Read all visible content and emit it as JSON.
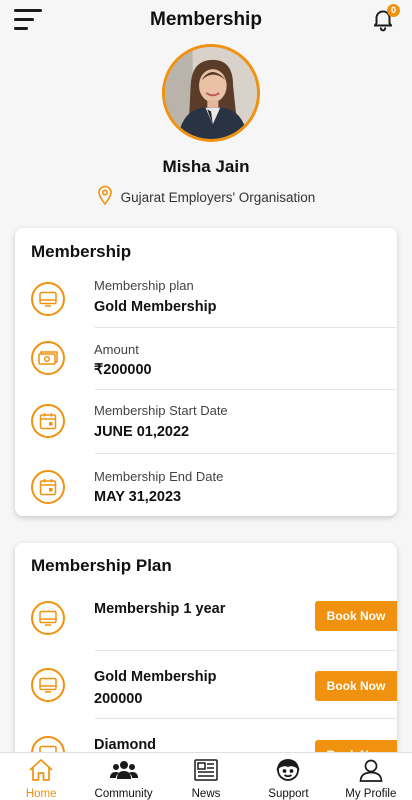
{
  "header": {
    "title": "Membership",
    "notification_count": "0"
  },
  "profile": {
    "name": "Misha Jain",
    "organisation": "Gujarat Employers' Organisation"
  },
  "membership_card": {
    "title": "Membership",
    "rows": [
      {
        "label": "Membership plan",
        "value": "Gold Membership",
        "icon": "membership-card-icon"
      },
      {
        "label": "Amount",
        "value": "₹200000",
        "icon": "cash-icon"
      },
      {
        "label": "Membership Start Date",
        "value": "JUNE 01,2022",
        "icon": "calendar-icon"
      },
      {
        "label": "Membership End Date",
        "value": "MAY 31,2023",
        "icon": "calendar-icon"
      }
    ]
  },
  "plans_card": {
    "title": "Membership Plan",
    "plans": [
      {
        "name": "Membership 1 year",
        "price": "",
        "button": "Book Now"
      },
      {
        "name": "Gold Membership",
        "price": "200000",
        "button": "Book Now"
      },
      {
        "name": "Diamond",
        "price": "",
        "button": "Book Now"
      }
    ]
  },
  "bottom_nav": {
    "items": [
      {
        "label": "Home",
        "icon": "home-icon",
        "active": true
      },
      {
        "label": "Community",
        "icon": "community-icon",
        "active": false
      },
      {
        "label": "News",
        "icon": "news-icon",
        "active": false
      },
      {
        "label": "Support",
        "icon": "support-icon",
        "active": false
      },
      {
        "label": "My Profile",
        "icon": "profile-icon",
        "active": false
      }
    ]
  },
  "colors": {
    "accent": "#f0920f",
    "background": "#f6f6f6",
    "card": "#ffffff"
  }
}
